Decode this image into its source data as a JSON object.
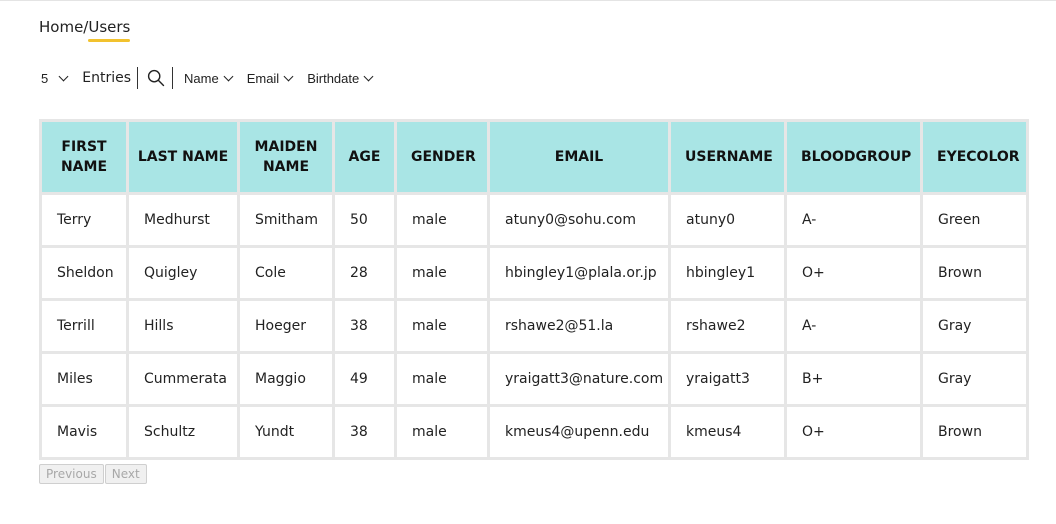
{
  "colors": {
    "header_bg": "#a9e5e5",
    "breadcrumb_underline": "#f2c22e",
    "grid_border": "#e6e6e6"
  },
  "breadcrumb": {
    "home": "Home",
    "separator": "/",
    "current": "Users"
  },
  "toolbar": {
    "entries_value": "5",
    "entries_label": "Entries",
    "search_icon": "search-icon",
    "filters": [
      {
        "label": "Name"
      },
      {
        "label": "Email"
      },
      {
        "label": "Birthdate"
      }
    ]
  },
  "table": {
    "headers": [
      "FIRST NAME",
      "LAST NAME",
      "MAIDEN NAME",
      "AGE",
      "GENDER",
      "EMAIL",
      "USERNAME",
      "BLOODGROUP",
      "EYECOLOR"
    ],
    "rows": [
      [
        "Terry",
        "Medhurst",
        "Smitham",
        "50",
        "male",
        "atuny0@sohu.com",
        "atuny0",
        "A-",
        "Green"
      ],
      [
        "Sheldon",
        "Quigley",
        "Cole",
        "28",
        "male",
        "hbingley1@plala.or.jp",
        "hbingley1",
        "O+",
        "Brown"
      ],
      [
        "Terrill",
        "Hills",
        "Hoeger",
        "38",
        "male",
        "rshawe2@51.la",
        "rshawe2",
        "A-",
        "Gray"
      ],
      [
        "Miles",
        "Cummerata",
        "Maggio",
        "49",
        "male",
        "yraigatt3@nature.com",
        "yraigatt3",
        "B+",
        "Gray"
      ],
      [
        "Mavis",
        "Schultz",
        "Yundt",
        "38",
        "male",
        "kmeus4@upenn.edu",
        "kmeus4",
        "O+",
        "Brown"
      ]
    ]
  },
  "pagination": {
    "previous_label": "Previous",
    "next_label": "Next"
  }
}
